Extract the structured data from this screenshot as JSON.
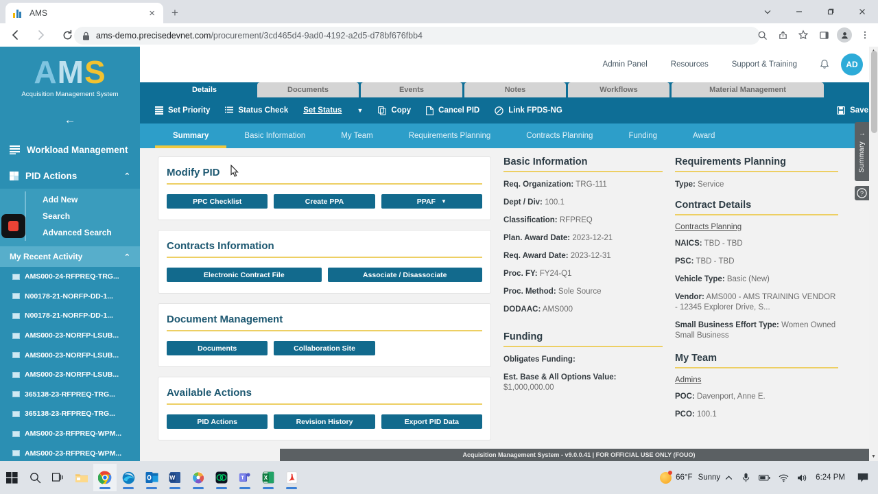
{
  "browser": {
    "tab_title": "AMS",
    "tab_close_label": "×",
    "new_tab_label": "+",
    "url_domain": "ams-demo.precisedevnet.com",
    "url_path": "/procurement/3cd465d4-9ad0-4192-a2d5-d78bf676fbb4",
    "window_controls": [
      "chevron-down",
      "minimize",
      "restore",
      "close"
    ],
    "toolbar_icons": [
      "zoom-icon",
      "share-icon",
      "bookmark-star-icon",
      "side-panel-icon",
      "profile-icon",
      "menu-kebab-icon"
    ]
  },
  "sidebar": {
    "logo_a": "A",
    "logo_m": "M",
    "logo_s": "S",
    "logo_subtitle": "Acquisition Management System",
    "collapse_label": "←",
    "items": [
      {
        "label": "Workload Management",
        "icon": "list-icon",
        "caret": ""
      },
      {
        "label": "PID Actions",
        "icon": "grid-icon",
        "caret": "⌃"
      }
    ],
    "pid_sub_items": [
      "Add New",
      "Search",
      "Advanced Search"
    ],
    "recent_header": "My Recent Activity",
    "recent_caret": "⌃",
    "recent_items": [
      "AMS000-24-RFPREQ-TRG...",
      "N00178-21-NORFP-DD-1...",
      "N00178-21-NORFP-DD-1...",
      "AMS000-23-NORFP-LSUB...",
      "AMS000-23-NORFP-LSUB...",
      "AMS000-23-NORFP-LSUB...",
      "365138-23-RFPREQ-TRG...",
      "365138-23-RFPREQ-TRG...",
      "AMS000-23-RFPREQ-WPM...",
      "AMS000-23-RFPREQ-WPM..."
    ]
  },
  "header": {
    "links": [
      "Admin Panel",
      "Resources",
      "Support & Training"
    ],
    "bell_icon": "bell-icon",
    "avatar_initials": "AD"
  },
  "page_tabs": [
    {
      "label": "Details",
      "active": true
    },
    {
      "label": "Documents",
      "active": false
    },
    {
      "label": "Events",
      "active": false
    },
    {
      "label": "Notes",
      "active": false
    },
    {
      "label": "Workflows",
      "active": false
    },
    {
      "label": "Material Management",
      "active": false
    }
  ],
  "toolbar": {
    "set_priority": "Set Priority",
    "status_check": "Status Check",
    "set_status": "Set Status",
    "set_status_caret": "▼",
    "copy": "Copy",
    "cancel_pid": "Cancel PID",
    "link_fpds": "Link FPDS-NG",
    "save": "Save"
  },
  "subnav": [
    {
      "label": "Summary",
      "active": true
    },
    {
      "label": "Basic Information",
      "active": false
    },
    {
      "label": "My Team",
      "active": false
    },
    {
      "label": "Requirements Planning",
      "active": false
    },
    {
      "label": "Contracts Planning",
      "active": false
    },
    {
      "label": "Funding",
      "active": false
    },
    {
      "label": "Award",
      "active": false
    }
  ],
  "cards": [
    {
      "title": "Modify PID",
      "buttons": [
        {
          "label": "PPC Checklist",
          "caret": ""
        },
        {
          "label": "Create PPA",
          "caret": ""
        },
        {
          "label": "PPAF",
          "caret": "▼"
        }
      ]
    },
    {
      "title": "Contracts Information",
      "buttons": [
        {
          "label": "Electronic Contract File",
          "caret": ""
        },
        {
          "label": "Associate / Disassociate",
          "caret": ""
        }
      ]
    },
    {
      "title": "Document Management",
      "buttons": [
        {
          "label": "Documents",
          "caret": ""
        },
        {
          "label": "Collaboration Site",
          "caret": ""
        }
      ]
    },
    {
      "title": "Available Actions",
      "buttons": [
        {
          "label": "PID Actions",
          "caret": ""
        },
        {
          "label": "Revision History",
          "caret": ""
        },
        {
          "label": "Export PID Data",
          "caret": ""
        }
      ]
    }
  ],
  "basic_information": {
    "title": "Basic Information",
    "fields": [
      {
        "label": "Req. Organization:",
        "value": "TRG-111"
      },
      {
        "label": "Dept / Div:",
        "value": "100.1"
      },
      {
        "label": "Classification:",
        "value": "RFPREQ"
      },
      {
        "label": "Plan. Award Date:",
        "value": "2023-12-21"
      },
      {
        "label": "Req. Award Date:",
        "value": "2023-12-31"
      },
      {
        "label": "Proc. FY:",
        "value": "FY24-Q1"
      },
      {
        "label": "Proc. Method:",
        "value": "Sole Source"
      },
      {
        "label": "DODAAC:",
        "value": "AMS000"
      }
    ]
  },
  "funding": {
    "title": "Funding",
    "fields": [
      {
        "label": "Obligates Funding:",
        "value": ""
      },
      {
        "label": "Est. Base & All Options Value:",
        "value": "$1,000,000.00"
      }
    ]
  },
  "requirements_planning": {
    "title": "Requirements Planning",
    "fields": [
      {
        "label": "Type:",
        "value": "Service"
      }
    ]
  },
  "contract_details": {
    "title": "Contract Details",
    "link": "Contracts Planning",
    "fields": [
      {
        "label": "NAICS:",
        "value": "TBD - TBD"
      },
      {
        "label": "PSC:",
        "value": "TBD - TBD"
      },
      {
        "label": "Vehicle Type:",
        "value": "Basic (New)"
      },
      {
        "label": "Vendor:",
        "value": "AMS000 - AMS TRAINING VENDOR - 12345 Explorer Drive, S..."
      },
      {
        "label": "Small Business Effort Type:",
        "value": "Women Owned Small Business"
      }
    ]
  },
  "my_team": {
    "title": "My Team",
    "link": "Admins",
    "fields": [
      {
        "label": "POC:",
        "value": "Davenport, Anne E."
      },
      {
        "label": "PCO:",
        "value": "100.1"
      }
    ]
  },
  "rail": {
    "summary_label": "Summary",
    "summary_arrow": "←",
    "help_label": "?"
  },
  "app_footer": "Acquisition Management System - v9.0.0.41 | FOR OFFICIAL USE ONLY (FOUO)",
  "taskbar": {
    "items": [
      "windows-start-icon",
      "search-icon",
      "task-view-icon",
      "file-explorer-icon",
      "chrome-icon",
      "edge-icon",
      "outlook-icon",
      "word-icon",
      "photos-icon",
      "webex-icon",
      "teams-icon",
      "excel-icon",
      "acrobat-icon"
    ],
    "weather_temp": "66°F",
    "weather_cond": "Sunny",
    "chevron": "⌃",
    "tray_icons": [
      "microphone-icon",
      "battery-icon",
      "wifi-icon",
      "volume-icon"
    ],
    "clock": "6:24 PM",
    "notification_icon": "notification-icon"
  },
  "colors": {
    "brand_dark": "#0e6e96",
    "brand_mid": "#2d9ec9",
    "sidebar": "#2b8fb3",
    "accent_gold": "#edcf63",
    "button": "#126a8d"
  }
}
